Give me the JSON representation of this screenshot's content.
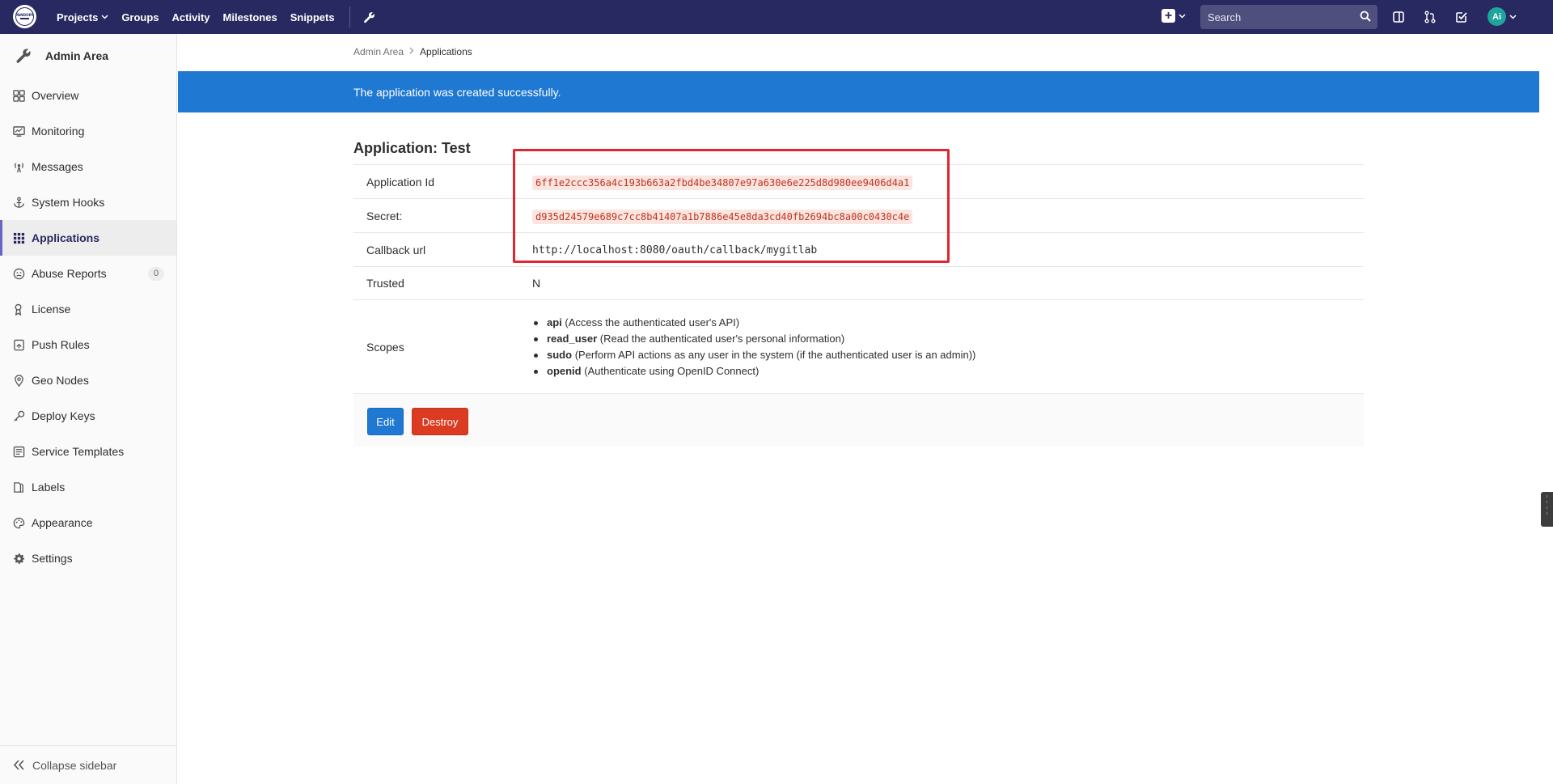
{
  "navbar": {
    "logo_alt": "PANDORY",
    "links": [
      {
        "label": "Projects",
        "has_caret": true
      },
      {
        "label": "Groups"
      },
      {
        "label": "Activity"
      },
      {
        "label": "Milestones"
      },
      {
        "label": "Snippets"
      }
    ],
    "search_placeholder": "Search",
    "avatar_initial": "Ai"
  },
  "sidebar": {
    "title": "Admin Area",
    "items": [
      {
        "label": "Overview",
        "icon": "overview-icon"
      },
      {
        "label": "Monitoring",
        "icon": "monitor-icon"
      },
      {
        "label": "Messages",
        "icon": "broadcast-icon"
      },
      {
        "label": "System Hooks",
        "icon": "anchor-icon"
      },
      {
        "label": "Applications",
        "icon": "apps-grid-icon",
        "active": true
      },
      {
        "label": "Abuse Reports",
        "icon": "smiley-icon",
        "badge": "0"
      },
      {
        "label": "License",
        "icon": "license-icon"
      },
      {
        "label": "Push Rules",
        "icon": "push-rules-icon"
      },
      {
        "label": "Geo Nodes",
        "icon": "geo-pin-icon"
      },
      {
        "label": "Deploy Keys",
        "icon": "key-icon"
      },
      {
        "label": "Service Templates",
        "icon": "template-icon"
      },
      {
        "label": "Labels",
        "icon": "labels-icon"
      },
      {
        "label": "Appearance",
        "icon": "palette-icon"
      },
      {
        "label": "Settings",
        "icon": "gear-icon"
      }
    ],
    "collapse_label": "Collapse sidebar"
  },
  "breadcrumb": {
    "parent": "Admin Area",
    "current": "Applications"
  },
  "flash": {
    "message": "The application was created successfully."
  },
  "application": {
    "title": "Application: Test",
    "rows": {
      "app_id_label": "Application Id",
      "app_id_value": "6ff1e2ccc356a4c193b663a2fbd4be34807e97a630e6e225d8d980ee9406d4a1",
      "secret_label": "Secret:",
      "secret_value": "d935d24579e689c7cc8b41407a1b7886e45e8da3cd40fb2694bc8a00c0430c4e",
      "callback_label": "Callback url",
      "callback_value": "http://localhost:8080/oauth/callback/mygitlab",
      "trusted_label": "Trusted",
      "trusted_value": "N",
      "scopes_label": "Scopes"
    },
    "scopes": [
      {
        "name": "api",
        "desc": "(Access the authenticated user's API)"
      },
      {
        "name": "read_user",
        "desc": "(Read the authenticated user's personal information)"
      },
      {
        "name": "sudo",
        "desc": "(Perform API actions as any user in the system (if the authenticated user is an admin))"
      },
      {
        "name": "openid",
        "desc": "(Authenticate using OpenID Connect)"
      }
    ]
  },
  "actions": {
    "edit_label": "Edit",
    "destroy_label": "Destroy"
  },
  "colors": {
    "navbar_bg": "#292961",
    "flash_bg": "#1f78d1",
    "destroy_bg": "#db3b21",
    "highlight_border": "#e0262e"
  }
}
